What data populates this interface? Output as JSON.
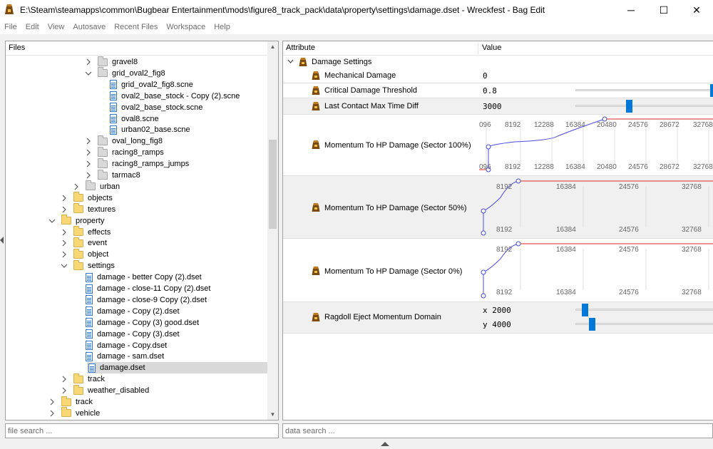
{
  "window": {
    "title": "E:\\Steam\\steamapps\\common\\Bugbear Entertainment\\mods\\figure8_track_pack\\data\\property\\settings\\damage.dset - Wreckfest - Bag Edit",
    "minimize": "─",
    "maximize": "☐",
    "close": "✕"
  },
  "menu": [
    "File",
    "Edit",
    "View",
    "Autosave",
    "Recent Files",
    "Workspace",
    "Help"
  ],
  "files": {
    "header": "Files",
    "tree": [
      {
        "label": "gravel8",
        "indent": 3,
        "type": "folder-grey",
        "chevron": "right"
      },
      {
        "label": "grid_oval2_fig8",
        "indent": 3,
        "type": "folder-grey",
        "chevron": "down"
      },
      {
        "label": "grid_oval2_fig8.scne",
        "indent": 4,
        "type": "file"
      },
      {
        "label": "oval2_base_stock - Copy (2).scne",
        "indent": 4,
        "type": "file"
      },
      {
        "label": "oval2_base_stock.scne",
        "indent": 4,
        "type": "file"
      },
      {
        "label": "oval8.scne",
        "indent": 4,
        "type": "file"
      },
      {
        "label": "urban02_base.scne",
        "indent": 4,
        "type": "file"
      },
      {
        "label": "oval_long_fig8",
        "indent": 3,
        "type": "folder-grey",
        "chevron": "right"
      },
      {
        "label": "racing8_ramps",
        "indent": 3,
        "type": "folder-grey",
        "chevron": "right"
      },
      {
        "label": "racing8_ramps_jumps",
        "indent": 3,
        "type": "folder-grey",
        "chevron": "right"
      },
      {
        "label": "tarmac8",
        "indent": 3,
        "type": "folder-grey",
        "chevron": "right"
      },
      {
        "label": "urban",
        "indent": 2,
        "type": "folder-grey",
        "chevron": "right"
      },
      {
        "label": "objects",
        "indent": 1,
        "type": "folder",
        "chevron": "right"
      },
      {
        "label": "textures",
        "indent": 1,
        "type": "folder",
        "chevron": "right"
      },
      {
        "label": "property",
        "indent": 0,
        "type": "folder",
        "chevron": "down"
      },
      {
        "label": "effects",
        "indent": 1,
        "type": "folder",
        "chevron": "right"
      },
      {
        "label": "event",
        "indent": 1,
        "type": "folder",
        "chevron": "right"
      },
      {
        "label": "object",
        "indent": 1,
        "type": "folder",
        "chevron": "right"
      },
      {
        "label": "settings",
        "indent": 1,
        "type": "folder",
        "chevron": "down"
      },
      {
        "label": "damage - better Copy (2).dset",
        "indent": 2,
        "type": "file"
      },
      {
        "label": "damage - close-11 Copy (2).dset",
        "indent": 2,
        "type": "file"
      },
      {
        "label": "damage - close-9 Copy (2).dset",
        "indent": 2,
        "type": "file"
      },
      {
        "label": "damage - Copy (2).dset",
        "indent": 2,
        "type": "file"
      },
      {
        "label": "damage - Copy (3) good.dset",
        "indent": 2,
        "type": "file"
      },
      {
        "label": "damage - Copy (3).dset",
        "indent": 2,
        "type": "file"
      },
      {
        "label": "damage - Copy.dset",
        "indent": 2,
        "type": "file"
      },
      {
        "label": "damage - sam.dset",
        "indent": 2,
        "type": "file"
      },
      {
        "label": "damage.dset",
        "indent": 2,
        "type": "file",
        "selected": true
      },
      {
        "label": "track",
        "indent": 1,
        "type": "folder",
        "chevron": "right"
      },
      {
        "label": "weather_disabled",
        "indent": 1,
        "type": "folder",
        "chevron": "right"
      },
      {
        "label": "track",
        "indent": 0,
        "type": "folder",
        "chevron": "right"
      },
      {
        "label": "vehicle",
        "indent": 0,
        "type": "folder",
        "chevron": "right"
      }
    ],
    "search_placeholder": "file search ..."
  },
  "attributes": {
    "col_attribute": "Attribute",
    "col_value": "Value",
    "group": "Damage Settings",
    "mechanical_damage": {
      "label": "Mechanical Damage",
      "value": "0"
    },
    "critical_threshold": {
      "label": "Critical Damage Threshold",
      "value": "0.8"
    },
    "last_contact": {
      "label": "Last Contact Max Time Diff",
      "value": "3000"
    },
    "momentum_100": {
      "label": "Momentum To HP Damage (Sector 100%)",
      "ticks": [
        "096",
        "8192",
        "12288",
        "16384",
        "20480",
        "24576",
        "28672",
        "32768"
      ]
    },
    "momentum_50": {
      "label": "Momentum To HP Damage (Sector 50%)",
      "ticks": [
        "8192",
        "16384",
        "24576",
        "32768"
      ]
    },
    "momentum_0": {
      "label": "Momentum To HP Damage (Sector 0%)",
      "ticks": [
        "8192",
        "16384",
        "24576",
        "32768"
      ]
    },
    "ragdoll": {
      "label": "Ragdoll Eject Momentum Domain",
      "x": "x 2000",
      "y": "y 4000"
    },
    "search_placeholder": "data search ..."
  },
  "colors": {
    "accent": "#0078d7",
    "curve": "#4a4adf",
    "limit": "#e05050",
    "folder": "#f8d775"
  },
  "icons": {
    "app": "wreckfest-icon",
    "bag": "bag-icon",
    "folder": "folder-icon",
    "file": "file-icon"
  }
}
